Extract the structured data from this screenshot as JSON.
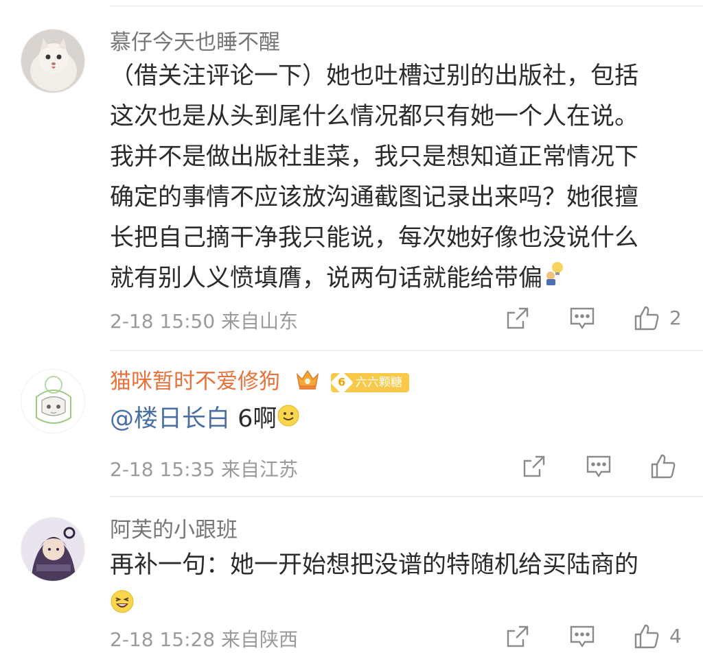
{
  "comments": [
    {
      "username": "慕仔今天也睡不醒",
      "lines": [
        "（借关注评论一下）她也吐槽过别的出版社，包括",
        "这次也是从头到尾什么情况都只有她一个人在说。",
        "我并不是做出版社韭菜，我只是想知道正常情况下",
        "确定的事情不应该放沟通截图记录出来吗？她很擅",
        "长把自己摘干净我只能说，每次她好像也没说什么",
        "就有别人义愤填膺，说两句话就能给带偏"
      ],
      "emoji": "lightbulb-guy-emoji",
      "meta": "2-18 15:50 来自山东",
      "likes": "2"
    },
    {
      "username": "猫咪暂时不爱修狗",
      "badge_level": "6",
      "badge_text": "六六颗糖",
      "mention": "@楼日长白",
      "text": " 6啊",
      "emoji": "smile-emoji",
      "meta": "2-18 15:35 来自江苏",
      "likes": ""
    },
    {
      "username": "阿芙的小跟班",
      "lines": [
        "再补一句：她一开始想把没谱的特随机给买陆商的"
      ],
      "emoji": "laugh-emoji",
      "meta": "2-18 15:28 来自陕西",
      "likes": "4"
    }
  ],
  "colors": {
    "username": "#777777",
    "vip_username": "#e8733a",
    "mention": "#4a6fa5",
    "meta": "#9a9a9a",
    "badge": "#f9c94a"
  }
}
